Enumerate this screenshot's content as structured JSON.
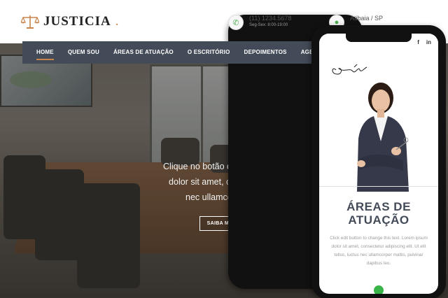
{
  "brand": {
    "name": "JUSTICIA",
    "dot": "."
  },
  "contact": {
    "phone": "(11) 1234.5678",
    "hours": "Seg-Sex: 8:00-19:00",
    "location": "Atibaia / SP"
  },
  "nav": {
    "items": [
      "HOME",
      "QUEM SOU",
      "ÁREAS DE ATUAÇÃO",
      "O ESCRITÓRIO",
      "DEPOIMENTOS",
      "AGENDE SUA CONSU"
    ],
    "active_index": 0
  },
  "hero": {
    "lines": [
      "Clique no botão de edição para alterar esse texto. Lo",
      "dolor sit amet, consectetur adipiscing elit. Ut elit te",
      "nec ullamcorper mattis, pulvinar dapibus l"
    ],
    "button": "SAIBA MAIS..."
  },
  "phone": {
    "social": [
      "f",
      "in"
    ],
    "heading_line1": "ÁREAS DE",
    "heading_line2": "ATUAÇÃO",
    "body": "Click edit button to change this text. Lorem ipsum dolor sit amet, consectetur adipiscing elit. Ut elit tellus, luctus nec ullamcorper mattis, pulvinar dapibus leo."
  },
  "colors": {
    "accent": "#c8844a",
    "nav_bg": "#444b58",
    "green": "#3ab54a"
  }
}
